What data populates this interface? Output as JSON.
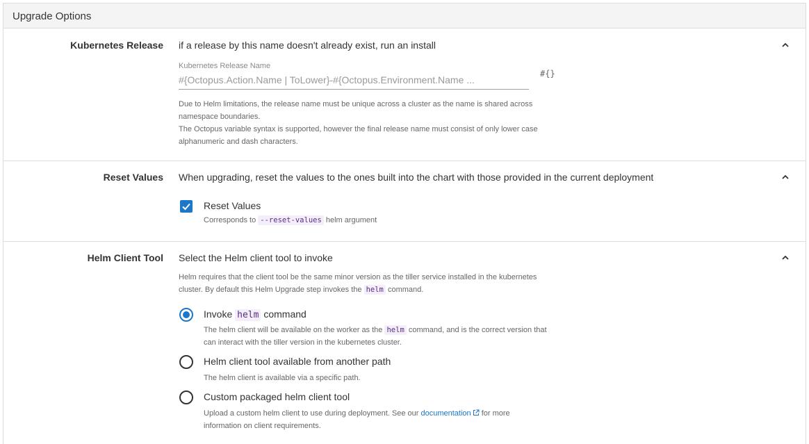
{
  "panel": {
    "title": "Upgrade Options"
  },
  "kubernetes_release": {
    "label": "Kubernetes Release",
    "summary": "if a release by this name doesn't already exist, run an install",
    "field_label": "Kubernetes Release Name",
    "field_value": "#{Octopus.Action.Name | ToLower}-#{Octopus.Environment.Name ...",
    "variable_button": "#{}",
    "help_lines": [
      "Due to Helm limitations, the release name must be unique across a cluster as the name is shared across",
      "namespace boundaries.",
      "The Octopus variable syntax is supported, however the final release name must consist of only lower case",
      "alphanumeric and dash characters."
    ]
  },
  "reset_values": {
    "label": "Reset Values",
    "summary": "When upgrading, reset the values to the ones built into the chart with those provided in the current deployment",
    "checkbox_label": "Reset Values",
    "checked": true,
    "hint_prefix": "Corresponds to",
    "hint_code": "--reset-values",
    "hint_suffix": "helm argument"
  },
  "helm_client_tool": {
    "label": "Helm Client Tool",
    "summary": "Select the Helm client tool to invoke",
    "help_line1": "Helm requires that the client tool be the same minor version as the tiller service installed in the kubernetes",
    "help_line2_prefix": "cluster. By default this Helm Upgrade step invokes the",
    "help_line2_code": "helm",
    "help_line2_suffix": "command.",
    "options": [
      {
        "label_prefix": "Invoke",
        "label_code": "helm",
        "label_suffix": "command",
        "selected": true,
        "desc_line1_prefix": "The helm client will be available on the worker as the",
        "desc_line1_code": "helm",
        "desc_line1_suffix": "command, and is the correct version that",
        "desc_line2": "can interact with the tiller version in the kubernetes cluster."
      },
      {
        "label": "Helm client tool available from another path",
        "selected": false,
        "desc": "The helm client is available via a specific path."
      },
      {
        "label": "Custom packaged helm client tool",
        "selected": false,
        "desc_line1_prefix": "Upload a custom helm client to use during deployment. See our",
        "desc_link": "documentation",
        "desc_line1_suffix": "for more",
        "desc_line2": "information on client requirements."
      }
    ]
  },
  "colors": {
    "accent": "#1a77ca",
    "code_bg": "#f3eef9",
    "code_fg": "#5a2d82",
    "border": "#dcdcdc"
  }
}
